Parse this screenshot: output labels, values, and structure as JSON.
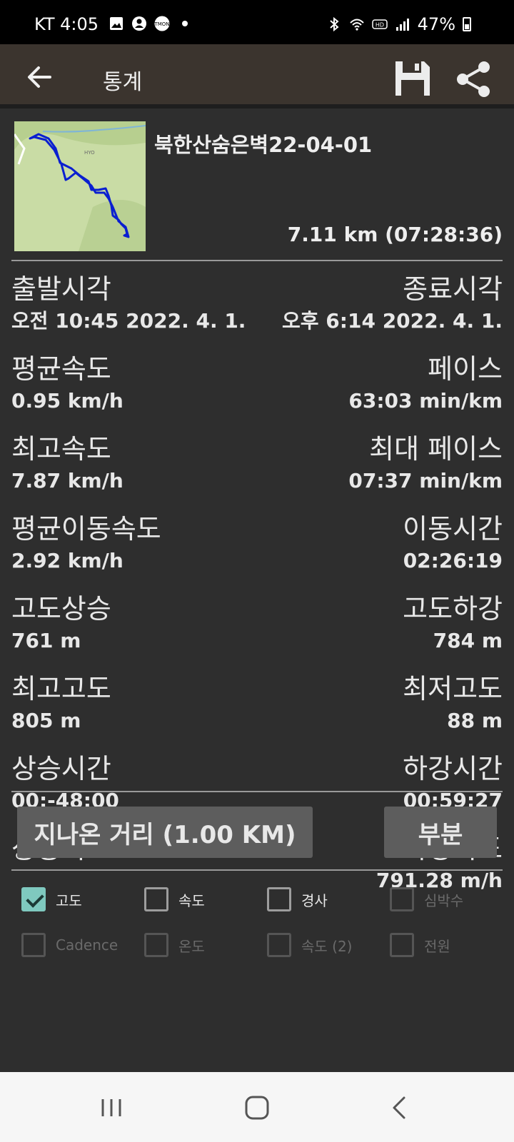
{
  "status_bar": {
    "carrier_time": "KT 4:05",
    "battery": "47%",
    "icons": [
      "image-icon",
      "person-icon",
      "tmon-icon",
      "dot-icon",
      "bluetooth-icon",
      "wifi-icon",
      "hd-icon",
      "signal-icon",
      "battery-icon"
    ]
  },
  "app_bar": {
    "title": "통계",
    "back_icon": "arrow-left-icon",
    "save_icon": "floppy-disk-icon",
    "share_icon": "share-icon"
  },
  "track": {
    "name": "북한산숨은벽22-04-01",
    "summary": "7.11 km (07:28:36)"
  },
  "stats": [
    {
      "left_label": "출발시각",
      "left_value": "오전 10:45 2022. 4. 1.",
      "right_label": "종료시각",
      "right_value": "오후 6:14 2022. 4. 1."
    },
    {
      "left_label": "평균속도",
      "left_value": "0.95 km/h",
      "right_label": "페이스",
      "right_value": "63:03 min/km"
    },
    {
      "left_label": "최고속도",
      "left_value": "7.87 km/h",
      "right_label": "최대 페이스",
      "right_value": "07:37 min/km"
    },
    {
      "left_label": "평균이동속도",
      "left_value": "2.92 km/h",
      "right_label": "이동시간",
      "right_value": "02:26:19"
    },
    {
      "left_label": "고도상승",
      "left_value": "761 m",
      "right_label": "고도하강",
      "right_value": "784 m"
    },
    {
      "left_label": "최고고도",
      "left_value": "805 m",
      "right_label": "최저고도",
      "right_value": "88 m"
    },
    {
      "left_label": "상승시간",
      "left_value": "00:-48:00",
      "right_label": "하강시간",
      "right_value": "00:59:27"
    },
    {
      "left_label": "상승속도",
      "left_value": "",
      "right_label": "하강속도",
      "right_value": "791.28 m/h"
    }
  ],
  "buttons": {
    "distance": "지나온 거리 (1.00  KM)",
    "partial": "부분"
  },
  "checkboxes": [
    {
      "label": "고도",
      "checked": true,
      "enabled": true
    },
    {
      "label": "속도",
      "checked": false,
      "enabled": true
    },
    {
      "label": "경사",
      "checked": false,
      "enabled": true
    },
    {
      "label": "심박수",
      "checked": false,
      "enabled": false
    },
    {
      "label": "Cadence",
      "checked": false,
      "enabled": false
    },
    {
      "label": "온도",
      "checked": false,
      "enabled": false
    },
    {
      "label": "속도 (2)",
      "checked": false,
      "enabled": false
    },
    {
      "label": "전원",
      "checked": false,
      "enabled": false
    }
  ],
  "colors": {
    "background": "#2e2e2e",
    "app_bar": "#3b342e",
    "check_accent": "#7fc9bf",
    "track_line": "#0a1fd0"
  }
}
